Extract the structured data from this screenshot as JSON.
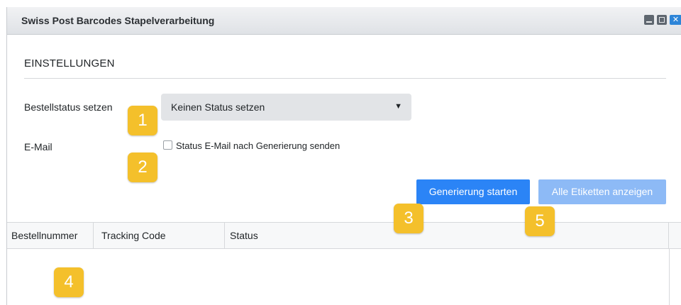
{
  "window": {
    "title": "Swiss Post Barcodes Stapelverarbeitung",
    "close_glyph": "✕"
  },
  "settings": {
    "heading": "EINSTELLUNGEN",
    "order_status_label": "Bestellstatus setzen",
    "order_status_value": "Keinen Status setzen",
    "email_label": "E-Mail",
    "email_checkbox_label": "Status E-Mail nach Generierung senden",
    "email_checkbox_checked": false
  },
  "actions": {
    "start_label": "Generierung starten",
    "show_labels_label": "Alle Etiketten anzeigen"
  },
  "table": {
    "columns": [
      "Bestellnummer",
      "Tracking Code",
      "Status"
    ],
    "rows": []
  },
  "markers": [
    "1",
    "2",
    "3",
    "4",
    "5"
  ],
  "colors": {
    "primary_button": "#2b84f6",
    "secondary_button": "#8dbaf6",
    "marker": "#f4c02b",
    "close_button": "#2d85d8"
  }
}
